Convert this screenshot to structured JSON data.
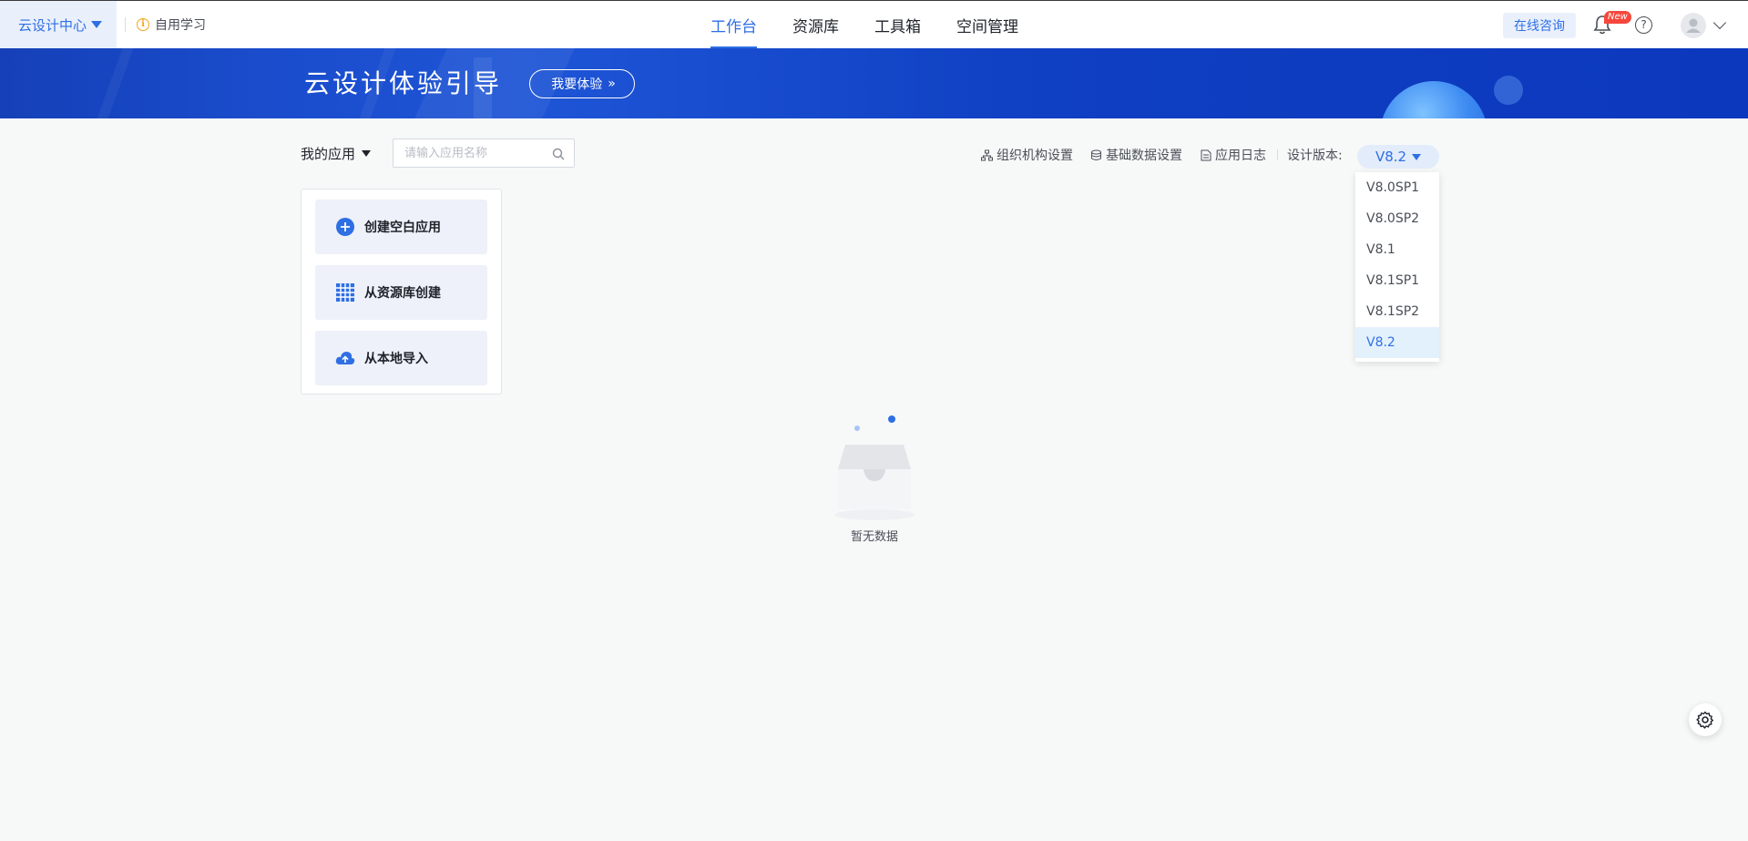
{
  "topbar": {
    "brand_label": "云设计中心",
    "self_learn_label": "自用学习",
    "nav": [
      {
        "label": "工作台",
        "active": true
      },
      {
        "label": "资源库",
        "active": false
      },
      {
        "label": "工具箱",
        "active": false
      },
      {
        "label": "空间管理",
        "active": false
      }
    ],
    "consult_label": "在线咨询",
    "new_badge": "New"
  },
  "banner": {
    "title": "云设计体验引导",
    "button_label": "我要体验"
  },
  "toolbar": {
    "my_apps_label": "我的应用",
    "search_placeholder": "请输入应用名称",
    "search_value": "",
    "org_settings": "组织机构设置",
    "basic_data_settings": "基础数据设置",
    "app_log": "应用日志",
    "version_label": "设计版本:",
    "version_selected": "V8.2"
  },
  "version_dropdown": {
    "options": [
      "V8.0SP1",
      "V8.0SP2",
      "V8.1",
      "V8.1SP1",
      "V8.1SP2",
      "V8.2"
    ],
    "selected": "V8.2"
  },
  "create_panel": {
    "items": [
      {
        "label": "创建空白应用",
        "icon": "plus-circle-icon"
      },
      {
        "label": "从资源库创建",
        "icon": "grid-icon"
      },
      {
        "label": "从本地导入",
        "icon": "cloud-upload-icon"
      }
    ]
  },
  "empty_state": {
    "text": "暂无数据"
  },
  "colors": {
    "accent": "#2f6fe4",
    "banner": "#1a4ccc",
    "badge": "#f5473c",
    "warning": "#f2a516"
  }
}
